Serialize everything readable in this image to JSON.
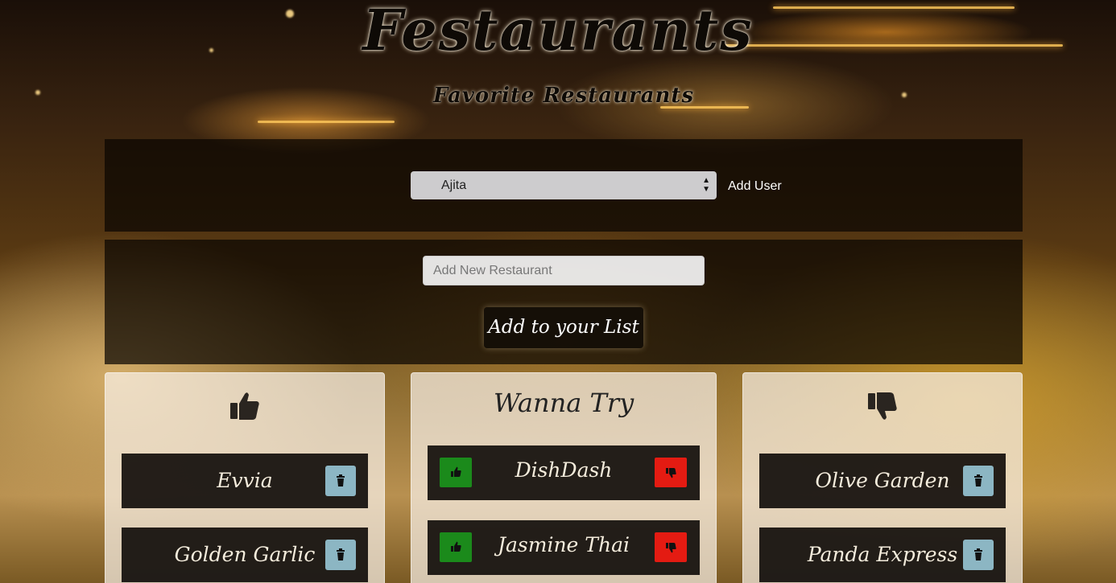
{
  "header": {
    "title": "Festaurants",
    "subtitle": "Favorite Restaurants"
  },
  "user_panel": {
    "selected_user": "Ajita",
    "add_user_label": "Add User"
  },
  "add_panel": {
    "input_placeholder": "Add New Restaurant",
    "add_button_label": "Add to your List"
  },
  "columns": {
    "liked": {
      "icon": "thumbs-up-icon",
      "items": [
        {
          "name": "Evvia"
        },
        {
          "name": "Golden Garlic"
        }
      ]
    },
    "wanna_try": {
      "heading": "Wanna Try",
      "items": [
        {
          "name": "DishDash"
        },
        {
          "name": "Jasmine Thai"
        }
      ]
    },
    "disliked": {
      "icon": "thumbs-down-icon",
      "items": [
        {
          "name": "Olive Garden"
        },
        {
          "name": "Panda Express"
        }
      ]
    }
  },
  "colors": {
    "upvote": "#1b8a1b",
    "downvote": "#e41b12",
    "trash": "#96c3d2"
  }
}
